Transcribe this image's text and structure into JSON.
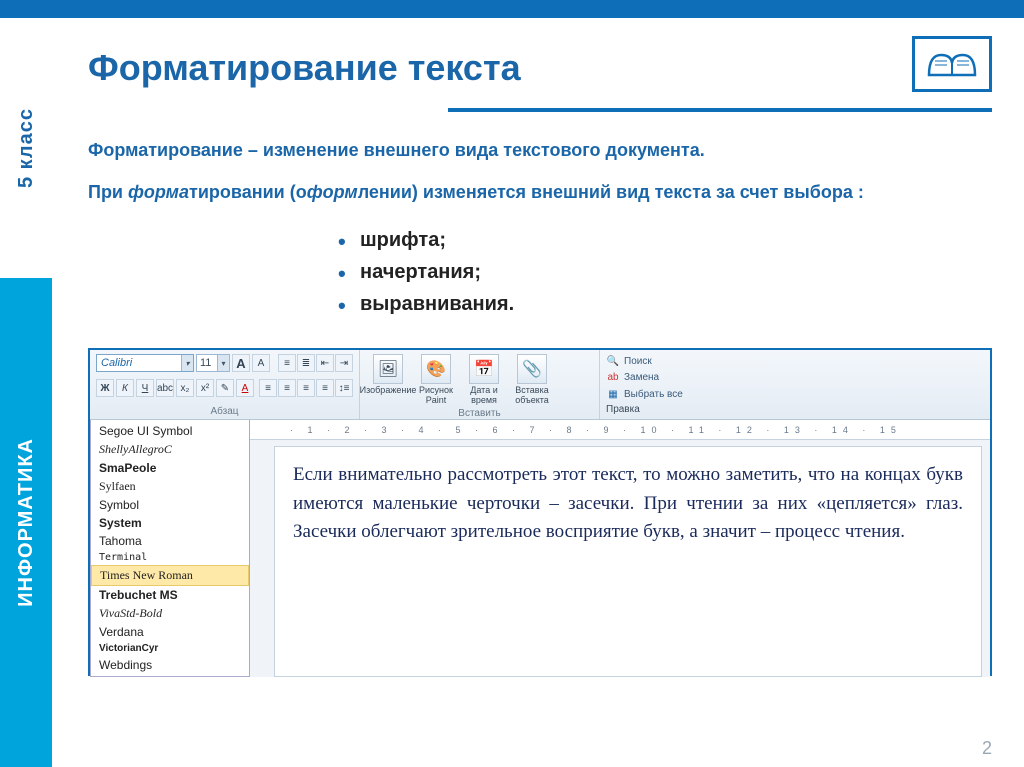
{
  "sidebar": {
    "class_label": "5 класс",
    "subject": "ИНФОРМАТИКА"
  },
  "title": "Форматирование текста",
  "definition": "Форматирование – изменение внешнего вида текстового документа.",
  "para2": {
    "p1_before": "При ",
    "p1_ital": "форма",
    "p1_mid": "тировании (о",
    "p2_ital": "форм",
    "p1_after": "лении) изменяется внешний вид текста за счет выбора :"
  },
  "bullets": [
    "шрифта;",
    "начертания;",
    "выравнивания."
  ],
  "ribbon": {
    "font_name": "Calibri",
    "font_size": "11",
    "btn_grow": "A",
    "btn_shrink": "A",
    "group_paragraph": "Абзац",
    "group_insert": "Вставить",
    "group_edit": "Правка",
    "insert": [
      {
        "glyph": "🖼",
        "label": "Изображение"
      },
      {
        "glyph": "🎨",
        "label": "Рисунок Paint"
      },
      {
        "glyph": "📅",
        "label": "Дата и время"
      },
      {
        "glyph": "📎",
        "label": "Вставка объекта"
      }
    ],
    "edit": [
      {
        "glyph": "🔍",
        "label": "Поиск"
      },
      {
        "glyph": "ab",
        "label": "Замена"
      },
      {
        "glyph": "▦",
        "label": "Выбрать все"
      }
    ]
  },
  "fontlist": [
    {
      "name": "Segoe UI Symbol",
      "style": ""
    },
    {
      "name": "ShellyAllegroC",
      "style": "font-family:cursive;font-style:italic"
    },
    {
      "name": "SmaPeole",
      "style": "font-weight:bold"
    },
    {
      "name": "Sylfaen",
      "style": "font-family:serif"
    },
    {
      "name": "Symbol",
      "style": ""
    },
    {
      "name": "System",
      "style": "font-weight:bold"
    },
    {
      "name": "Tahoma",
      "style": ""
    },
    {
      "name": "Terminal",
      "style": "font-family:monospace;font-size:10px"
    },
    {
      "name": "Times New Roman",
      "style": "font-family:'Times New Roman',serif",
      "selected": true
    },
    {
      "name": "Trebuchet MS",
      "style": "font-weight:bold"
    },
    {
      "name": "VivaStd-Bold",
      "style": "font-family:cursive;font-style:italic"
    },
    {
      "name": "Verdana",
      "style": ""
    },
    {
      "name": "VictorianCyr",
      "style": "font-weight:bold;font-size:10px"
    },
    {
      "name": "Webdings",
      "style": ""
    }
  ],
  "ruler": "· 1 · 2 · 3 · 4 · 5 · 6 · 7 · 8 · 9 · 10 · 11 · 12 · 13 · 14 · 15",
  "document_text": "Если внимательно рассмотреть этот текст, то можно заметить, что на концах букв имеются маленькие черточки – засечки. При чтении за них «цепляется» глаз. Засечки облегчают зрительное восприятие букв, а значит – процесс чтения.",
  "page_number": "2"
}
